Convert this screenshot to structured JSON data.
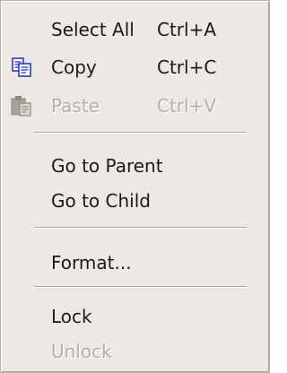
{
  "menu": {
    "items": {
      "select_all": {
        "label": "Select All",
        "shortcut": "Ctrl+A",
        "enabled": true
      },
      "copy": {
        "label": "Copy",
        "shortcut": "Ctrl+C",
        "enabled": true,
        "icon": "copy-icon"
      },
      "paste": {
        "label": "Paste",
        "shortcut": "Ctrl+V",
        "enabled": false,
        "icon": "paste-icon"
      },
      "go_to_parent": {
        "label": "Go to Parent",
        "enabled": true
      },
      "go_to_child": {
        "label": "Go to Child",
        "enabled": true
      },
      "format": {
        "label": "Format...",
        "enabled": true
      },
      "lock": {
        "label": "Lock",
        "enabled": true
      },
      "unlock": {
        "label": "Unlock",
        "enabled": false
      }
    }
  },
  "colors": {
    "menu_background": "#ece9e4",
    "text": "#1a1a1a",
    "disabled_text": "#b3b0aa",
    "copy_icon_blue": "#2a3bb5"
  }
}
